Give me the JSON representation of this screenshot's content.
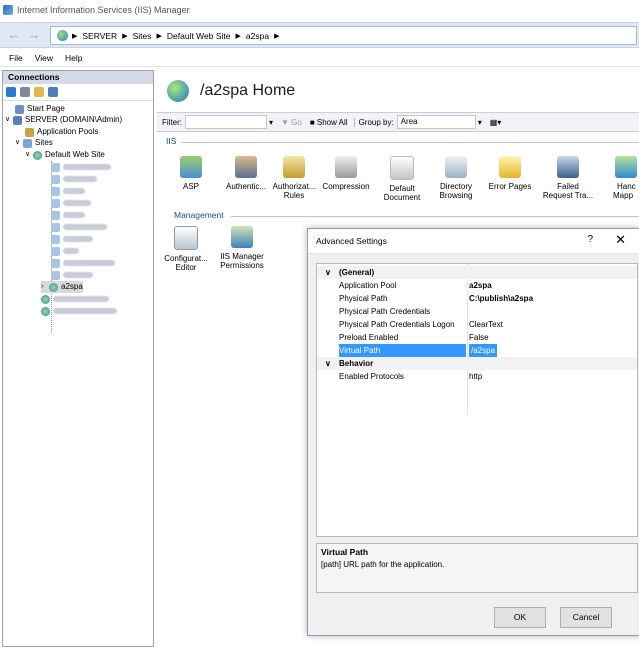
{
  "window": {
    "title": "Internet Information Services (IIS) Manager"
  },
  "address": {
    "crumbs": [
      "SERVER",
      "Sites",
      "Default Web Site",
      "a2spa"
    ]
  },
  "menu": [
    "File",
    "View",
    "Help"
  ],
  "connections": {
    "header": "Connections",
    "tree": {
      "start_page": "Start Page",
      "server": "SERVER (DOMAIN\\Admin)",
      "app_pools": "Application Pools",
      "sites": "Sites",
      "default_site": "Default Web Site",
      "selected": "a2spa"
    }
  },
  "main": {
    "title": "/a2spa Home",
    "filter": {
      "label": "Filter:",
      "go": "Go",
      "show_all": "Show All",
      "group_by_label": "Group by:",
      "group_by_value": "Area"
    },
    "sections": {
      "iis": "IIS",
      "management": "Management"
    },
    "iis_features": [
      {
        "l1": "ASP",
        "l2": ""
      },
      {
        "l1": "Authentic...",
        "l2": ""
      },
      {
        "l1": "Authorizat...",
        "l2": "Rules"
      },
      {
        "l1": "Compression",
        "l2": ""
      },
      {
        "l1": "Default",
        "l2": "Document"
      },
      {
        "l1": "Directory",
        "l2": "Browsing"
      },
      {
        "l1": "Error Pages",
        "l2": ""
      },
      {
        "l1": "Failed",
        "l2": "Request Tra..."
      },
      {
        "l1": "Hanc",
        "l2": "Mapp"
      }
    ],
    "management_features": [
      {
        "l1": "Configurat...",
        "l2": "Editor"
      },
      {
        "l1": "IIS Manager",
        "l2": "Permissions"
      }
    ]
  },
  "dialog": {
    "title": "Advanced Settings",
    "help": "?",
    "close": "✕",
    "general_header": "(General)",
    "behavior_header": "Behavior",
    "rows": {
      "app_pool": {
        "name": "Application Pool",
        "value": "a2spa"
      },
      "phys_path": {
        "name": "Physical Path",
        "value": "C:\\publish\\a2spa"
      },
      "phys_cred": {
        "name": "Physical Path Credentials",
        "value": ""
      },
      "phys_logon": {
        "name": "Physical Path Credentials Logon",
        "value": "ClearText"
      },
      "preload": {
        "name": "Preload Enabled",
        "value": "False"
      },
      "virtual_path": {
        "name": "Virtual Path",
        "value": "/a2spa"
      },
      "protocols": {
        "name": "Enabled Protocols",
        "value": "http"
      }
    },
    "description": {
      "title": "Virtual Path",
      "text": "[path] URL path for the application."
    },
    "ok": "OK",
    "cancel": "Cancel"
  },
  "colors": {
    "selection": "#3399ff",
    "section_text": "#1a4f93"
  }
}
